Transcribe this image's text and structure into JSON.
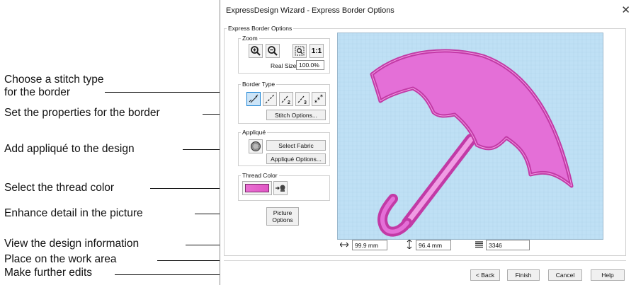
{
  "callouts": {
    "stitch_type": [
      "Choose a stitch type",
      "for the border"
    ],
    "properties": "Set the properties for the border",
    "applique": "Add appliqué to the design",
    "thread": "Select the thread color",
    "enhance": "Enhance detail in the picture",
    "info": "View the design information",
    "place": "Place on the work area",
    "edits": "Make further edits"
  },
  "dialog": {
    "title": "ExpressDesign Wizard - Express Border Options",
    "group_title": "Express Border Options",
    "zoom": {
      "label": "Zoom",
      "one_to_one": "1:1",
      "real_size_label": "Real Size",
      "real_size_value": "100.0%"
    },
    "border_type": {
      "label": "Border Type",
      "stitch_options": "Stitch Options..."
    },
    "applique": {
      "label": "Appliqué",
      "select_fabric": "Select Fabric",
      "applique_options": "Appliqué Options..."
    },
    "thread_color": {
      "label": "Thread Color",
      "color": "#e055c4"
    },
    "picture_options": [
      "Picture",
      "Options"
    ],
    "info": {
      "width": "99.9 mm",
      "height": "96.4 mm",
      "stitches": "3346"
    },
    "buttons": {
      "back": "< Back",
      "finish": "Finish",
      "cancel": "Cancel",
      "help": "Help"
    }
  },
  "colors": {
    "preview_bg": "#bfe0f5",
    "fill": "#e46fd7",
    "satin": "#c23aa6"
  }
}
